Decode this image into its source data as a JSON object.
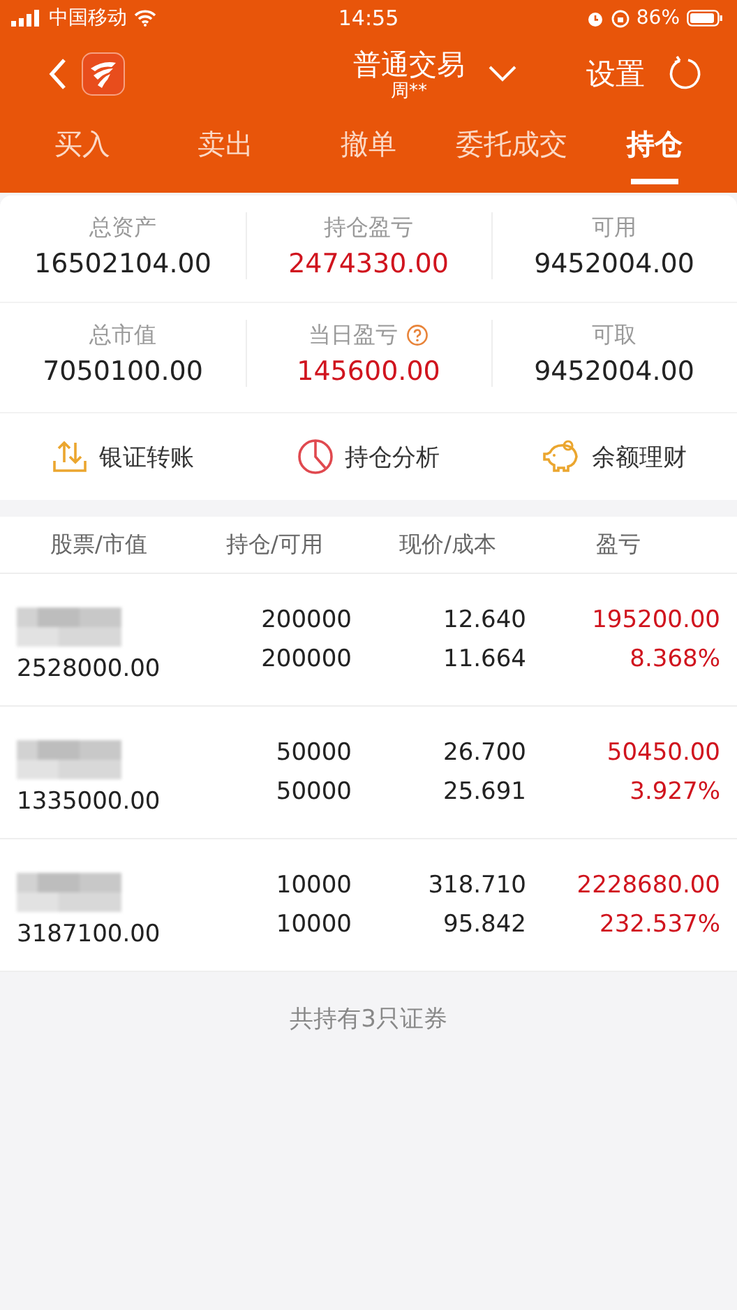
{
  "status_bar": {
    "carrier": "中国移动",
    "time": "14:55",
    "battery": "86%"
  },
  "header": {
    "title": "普通交易",
    "subtitle": "周**",
    "settings": "设置"
  },
  "tabs": [
    {
      "label": "买入",
      "selected": false
    },
    {
      "label": "卖出",
      "selected": false
    },
    {
      "label": "撤单",
      "selected": false
    },
    {
      "label": "委托成交",
      "selected": false
    },
    {
      "label": "持仓",
      "selected": true
    }
  ],
  "summary": [
    {
      "label": "总资产",
      "value": "16502104.00",
      "color": "#222222"
    },
    {
      "label": "持仓盈亏",
      "value": "2474330.00",
      "color": "#d0141e"
    },
    {
      "label": "可用",
      "value": "9452004.00",
      "color": "#222222"
    },
    {
      "label": "总市值",
      "value": "7050100.00",
      "color": "#222222"
    },
    {
      "label": "当日盈亏",
      "value": "145600.00",
      "color": "#d0141e",
      "help": true
    },
    {
      "label": "可取",
      "value": "9452004.00",
      "color": "#222222"
    }
  ],
  "actions": [
    {
      "label": "银证转账",
      "kind": "transfer"
    },
    {
      "label": "持仓分析",
      "kind": "analysis"
    },
    {
      "label": "余额理财",
      "kind": "savings"
    }
  ],
  "table": {
    "columns": [
      "股票/市值",
      "持仓/可用",
      "现价/成本",
      "盈亏"
    ],
    "rows": [
      {
        "market_value": "2528000.00",
        "holding": "200000",
        "available": "200000",
        "price": "12.640",
        "cost": "11.664",
        "profit": "195200.00",
        "profit_pct": "8.368%",
        "color": "#d0141e"
      },
      {
        "market_value": "1335000.00",
        "holding": "50000",
        "available": "50000",
        "price": "26.700",
        "cost": "25.691",
        "profit": "50450.00",
        "profit_pct": "3.927%",
        "color": "#d0141e"
      },
      {
        "market_value": "3187100.00",
        "holding": "10000",
        "available": "10000",
        "price": "318.710",
        "cost": "95.842",
        "profit": "2228680.00",
        "profit_pct": "232.537%",
        "color": "#d0141e"
      }
    ]
  },
  "footer": "共持有3只证券"
}
